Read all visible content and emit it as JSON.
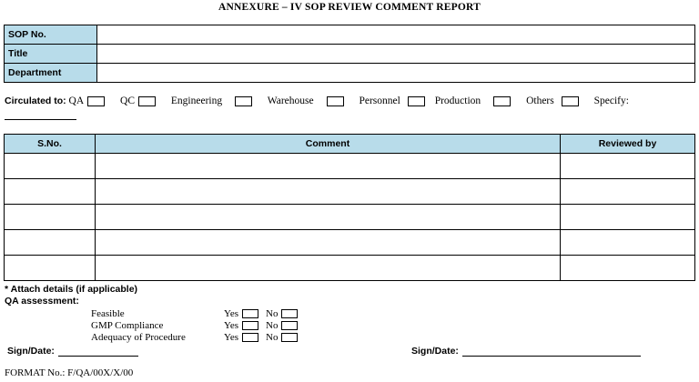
{
  "title": "ANNEXURE – IV  SOP REVIEW COMMENT REPORT",
  "info_rows": [
    "SOP No.",
    "Title",
    "Department"
  ],
  "circulated": {
    "label": "Circulated to:",
    "options": [
      "QA",
      "QC",
      "Engineering",
      "Warehouse",
      "Personnel",
      "Production",
      "Others"
    ],
    "specify": "Specify:"
  },
  "comments_table": {
    "headers": [
      "S.No.",
      "Comment",
      "Reviewed by"
    ],
    "empty_rows": 5
  },
  "attach_note": "* Attach details (if applicable)",
  "qa": {
    "heading": "QA assessment:",
    "criteria": [
      "Feasible",
      "GMP Compliance",
      "Adequacy of Procedure"
    ],
    "yes": "Yes",
    "no": "No"
  },
  "sign_label": "Sign/Date:",
  "format_no": "FORMAT No.: F/QA/00X/X/00"
}
